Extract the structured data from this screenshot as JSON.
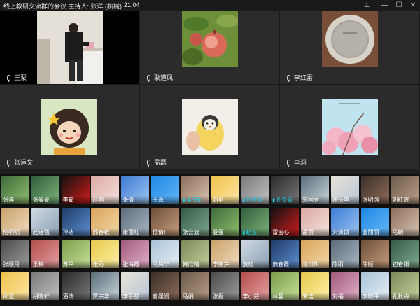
{
  "window": {
    "title": "线上教研交流群的会议 主持人: 张洋 (机械)",
    "time": "21:04",
    "controls": {
      "pin": "⊥",
      "minimize": "—",
      "maximize": "☐",
      "close": "✕"
    }
  },
  "video_tiles": [
    {
      "name": "王栗"
    },
    {
      "name": "耿道凤"
    },
    {
      "name": "李红雷"
    },
    {
      "name": "张道文"
    },
    {
      "name": "孟磊"
    },
    {
      "name": "李莉"
    }
  ],
  "participants": [
    [
      "张洋",
      "张曼曼",
      "李茹",
      "赵鹤",
      "张倩",
      "王永",
      "孟庆田",
      "刘星",
      "刘婷婷",
      "孔令青",
      "宋国秀",
      "褚衍华",
      "张明强",
      "刘红霞"
    ],
    [
      "杨明明",
      "赵连强",
      "孙洁",
      "邢春艳",
      "康丽红",
      "徐倩广",
      "张会波",
      "曼曼",
      "赵东",
      "雷宝心",
      "孟丽",
      "刘清锁",
      "姜丽丽",
      "马婉"
    ],
    [
      "张顺月",
      "王楠",
      "苏平",
      "张秀",
      "张海霞",
      "马凤华",
      "韩欣晴",
      "李建芹",
      "淑红",
      "燕春霞",
      "陈琪琪",
      "陈雨",
      "陈顺",
      "初春阳"
    ],
    [
      "孙慧",
      "胡晓轩",
      "潘涛",
      "贾宗华",
      "李菲芬",
      "曹媛媛",
      "马娟",
      "张振",
      "李小芬",
      "林蓉",
      "宋洁",
      "刘福",
      "李晓平",
      "孔秋梅"
    ]
  ],
  "highlighted": [
    "孔令青",
    "赵东",
    "刘婷婷",
    "孟庆田"
  ]
}
